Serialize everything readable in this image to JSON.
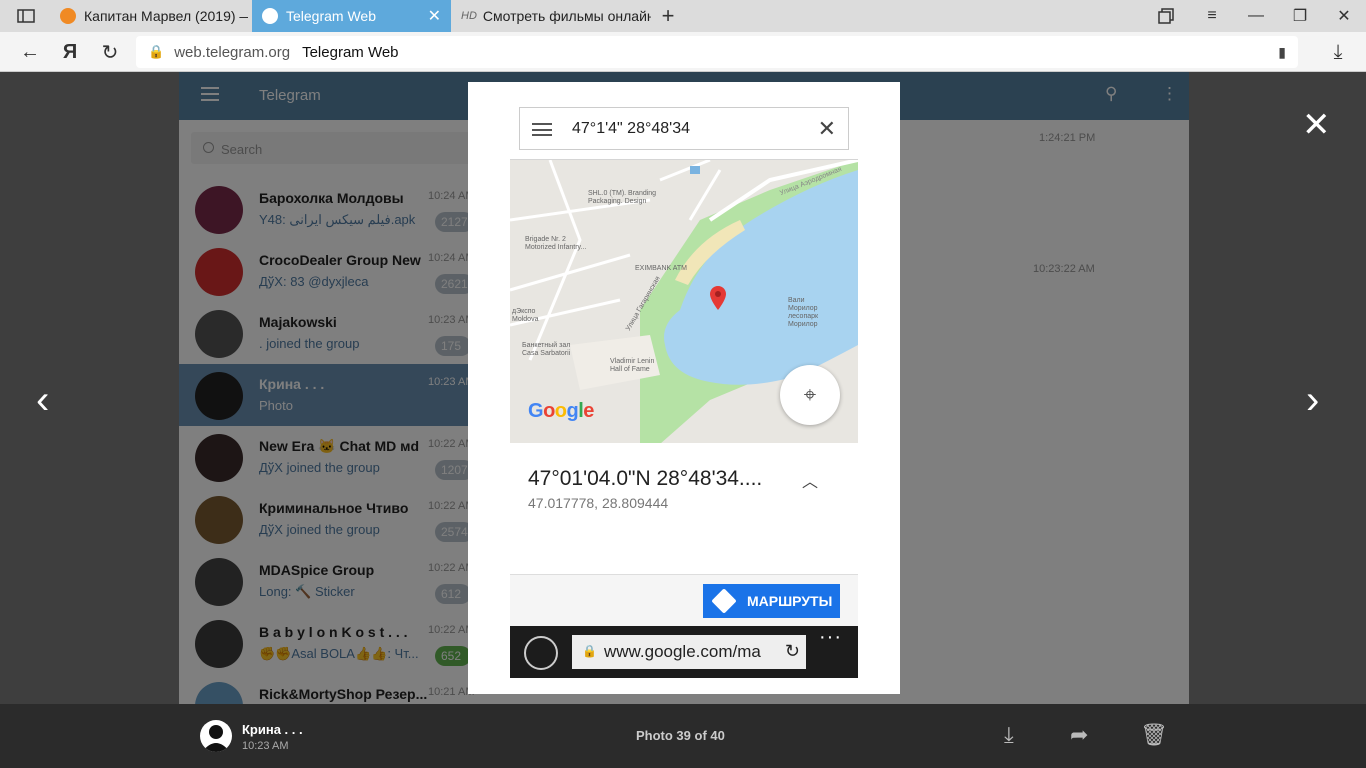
{
  "browser": {
    "tabs": [
      {
        "title": "Капитан Марвел (2019) —",
        "active": false
      },
      {
        "title": "Telegram Web",
        "active": true
      },
      {
        "title": "Смотреть фильмы онлайн",
        "active": false
      }
    ],
    "tab3_prefix": "HD",
    "url_domain": "web.telegram.org",
    "page_title": "Telegram Web"
  },
  "telegram": {
    "brand": "Telegram",
    "search_placeholder": "Search",
    "chats": [
      {
        "name": "Барохолка Молдовы",
        "last": "Y48: فیلم سیکس ایرانی.apk",
        "time": "10:24 AM",
        "badge": "2127",
        "color": "#7a2b4a"
      },
      {
        "name": "CrocoDealer Group New",
        "last": "ДўХ: 83 @dyxjleca",
        "time": "10:24 AM",
        "badge": "2621",
        "color": "#d32f2f"
      },
      {
        "name": "Majakowski",
        "last": ". joined the group",
        "time": "10:23 AM",
        "badge": "175",
        "color": "#555555"
      },
      {
        "name": "Крина . . .",
        "last": "Photo",
        "time": "10:23 AM",
        "badge": "",
        "color": "#222222"
      },
      {
        "name": "New Era 🐱 Chat MD мd",
        "last": "ДўХ joined the group",
        "time": "10:22 AM",
        "badge": "1207",
        "color": "#3a2a2a"
      },
      {
        "name": "Криминальное Чтиво",
        "last": "ДўХ joined the group",
        "time": "10:22 AM",
        "badge": "2574",
        "color": "#7a5a30"
      },
      {
        "name": "MDASpice Group",
        "last": "Long: 🔨 Sticker",
        "time": "10:22 AM",
        "badge": "612",
        "color": "#444444"
      },
      {
        "name": "B a b y l o n K o s t . . .",
        "last": "✊✊Asal BOLA👍👍: Чт...",
        "time": "10:22 AM",
        "badge": "652",
        "color": "#3c3c3c"
      },
      {
        "name": "Rick&MortyShop Резер...",
        "last": "",
        "time": "10:21 AM",
        "badge": "",
        "color": "#6aa0c8"
      }
    ],
    "right_times": [
      "1:24:21 PM",
      "10:23:22 AM"
    ]
  },
  "photo": {
    "search_query": "47°1'4\" 28°48'34",
    "coords_dms": "47°01'04.0\"N 28°48'34....",
    "coords_decimal": "47.017778, 28.809444",
    "route_button": "МАРШРУТЫ",
    "google_logo": "Google",
    "mobile_url": "www.google.com/ma",
    "map_labels": {
      "shl": "SHL.0 (TM). Branding\nPackaging. Design",
      "brigade": "Brigade Nr. 2\nMotorized Infantry...",
      "eximbank": "EXIMBANK ATM",
      "lake": "Вали\nМорилор\nлесопарк\nМорилор",
      "expo": "дЭкспо\nMoldova",
      "banket": "Банкетный зал\nCasa Sarbatorii",
      "lenin": "Vladimir Lenin\nHall of Fame",
      "street1": "Улица Гагаринская",
      "street2": "Улица Аэродромная"
    }
  },
  "viewer": {
    "sender": "Крина . . .",
    "time": "10:23 AM",
    "counter": "Photo 39 of 40"
  },
  "colors": {
    "telegram_header": "#5682a3",
    "active_chat": "#6a90b3",
    "active_tab": "#5ea9dc",
    "route_blue": "#1a73e8",
    "lake": "#a8d3f0",
    "park": "#b5e2a5"
  }
}
